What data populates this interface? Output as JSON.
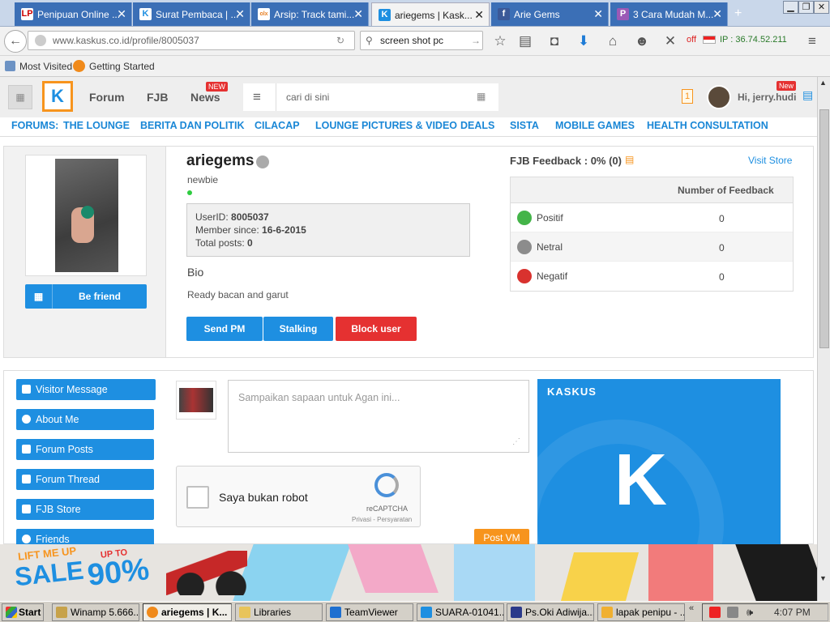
{
  "browser": {
    "tabs": [
      {
        "label": "Penipuan Online ...",
        "icon": "LP"
      },
      {
        "label": "Surat Pembaca | ...",
        "icon": "K"
      },
      {
        "label": "Arsip: Track tami...",
        "icon": "olx"
      },
      {
        "label": "ariegems | Kask...",
        "icon": "K"
      },
      {
        "label": "Arie Gems",
        "icon": "f"
      },
      {
        "label": "3 Cara Mudah M...",
        "icon": "P"
      }
    ],
    "url": "www.kaskus.co.id/profile/8005037",
    "search_value": "screen shot pc",
    "ip_off": "off",
    "ip_text": "IP : 36.74.52.211",
    "bookmarks": [
      "Most Visited",
      "Getting Started"
    ]
  },
  "kaskus": {
    "nav": {
      "forum": "Forum",
      "fjb": "FJB",
      "news": "News",
      "new_badge": "NEW",
      "search_placeholder": "cari di sini",
      "notif_count": "1",
      "greeting": "Hi, jerry.hudi",
      "new_badge2": "New"
    },
    "forums_label": "FORUMS:",
    "forums": [
      "THE LOUNGE",
      "BERITA DAN POLITIK",
      "CILACAP",
      "LOUNGE PICTURES & VIDEO",
      "DEALS",
      "SISTA",
      "MOBILE GAMES",
      "HEALTH CONSULTATION"
    ],
    "profile": {
      "username": "ariegems",
      "rank": "newbie",
      "userid_label": "UserID:",
      "userid": "8005037",
      "member_label": "Member since:",
      "member_since": "16-6-2015",
      "posts_label": "Total posts:",
      "posts": "0",
      "bio_heading": "Bio",
      "bio_text": "Ready bacan and garut",
      "be_friend": "Be friend",
      "send_pm": "Send PM",
      "stalking": "Stalking",
      "block_user": "Block user"
    },
    "feedback": {
      "title": "FJB Feedback : 0% (0)",
      "visit_store": "Visit Store",
      "column": "Number of Feedback",
      "rows": [
        {
          "label": "Positif",
          "value": "0",
          "color": "#44b449"
        },
        {
          "label": "Netral",
          "value": "0",
          "color": "#8c8c8c"
        },
        {
          "label": "Negatif",
          "value": "0",
          "color": "#d9322e"
        }
      ]
    },
    "menu": [
      "Visitor Message",
      "About Me",
      "Forum Posts",
      "Forum Thread",
      "FJB Store",
      "Friends"
    ],
    "vm_placeholder": "Sampaikan sapaan untuk Agan ini...",
    "captcha_label": "Saya bukan robot",
    "captcha_brand": "reCAPTCHA",
    "captcha_links": "Privasi - Persyaratan",
    "post_vm": "Post VM",
    "ad_logo": "KASKUS",
    "banner": {
      "line1": "LIFT ME UP",
      "line2": "SALE",
      "upto": "UP TO",
      "pct": "90%"
    }
  },
  "taskbar": {
    "start": "Start",
    "items": [
      "Winamp 5.666...",
      "ariegems | K...",
      "Libraries",
      "TeamViewer",
      "SUARA-01041...",
      "Ps.Oki Adiwija...",
      "lapak penipu - ..."
    ],
    "clock": "4:07 PM"
  }
}
